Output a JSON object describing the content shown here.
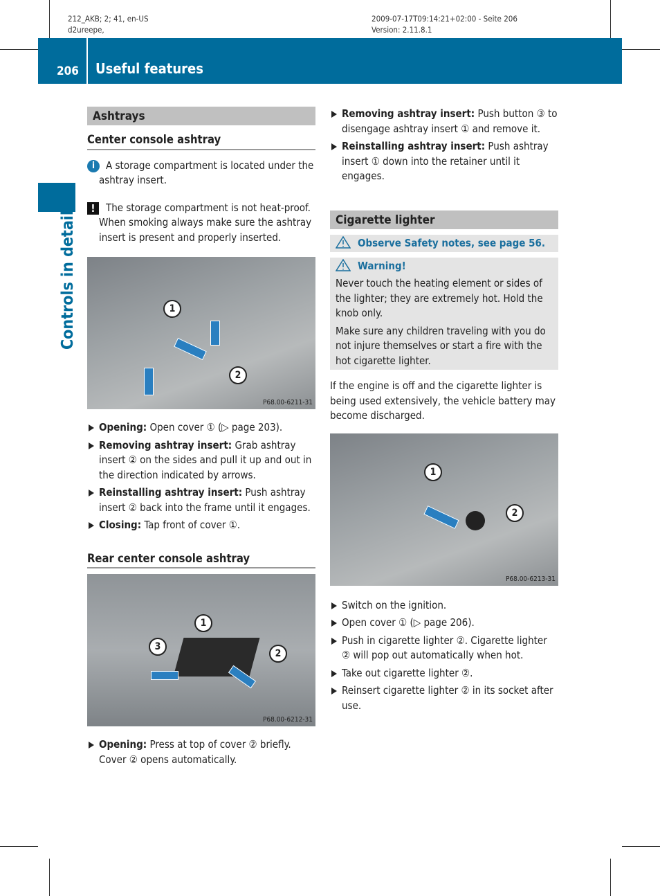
{
  "meta": {
    "left1": "212_AKB; 2; 41, en-US",
    "left2": "d2ureepe,",
    "right1": "2009-07-17T09:14:21+02:00 - Seite 206",
    "right2": "Version: 2.11.8.1"
  },
  "header": {
    "page_number": "206",
    "title": "Useful features",
    "accent": "#006c9c"
  },
  "side_tab": "Controls in detail",
  "left": {
    "section": "Ashtrays",
    "sub1": "Center console ashtray",
    "info_note": "A storage compartment is located under the ashtray insert.",
    "caution_note": "The storage compartment is not heat-proof. When smoking always make sure the ashtray insert is present and properly inserted.",
    "photo1": {
      "caption": "P68.00-6211-31",
      "callouts": [
        "1",
        "2"
      ]
    },
    "steps1": [
      {
        "bold": "Opening:",
        "text": " Open cover ① (▷ page 203)."
      },
      {
        "bold": "Removing ashtray insert:",
        "text": " Grab ashtray insert ② on the sides and pull it up and out in the direction indicated by arrows."
      },
      {
        "bold": "Reinstalling ashtray insert:",
        "text": " Push ashtray insert ② back into the frame until it engages."
      },
      {
        "bold": "Closing:",
        "text": " Tap front of cover ①."
      }
    ],
    "sub2": "Rear center console ashtray",
    "photo2": {
      "caption": "P68.00-6212-31",
      "callouts": [
        "1",
        "2",
        "3"
      ]
    },
    "steps2": [
      {
        "bold": "Opening:",
        "text": " Press at top of cover ② briefly. Cover ② opens automatically."
      }
    ]
  },
  "right": {
    "steps0": [
      {
        "bold": "Removing ashtray insert:",
        "text": " Push button ③ to disengage ashtray insert ① and remove it."
      },
      {
        "bold": "Reinstalling ashtray insert:",
        "text": " Push ashtray insert ① down into the retainer until it engages."
      }
    ],
    "section": "Cigarette lighter",
    "safety": "Observe Safety notes, see page 56.",
    "warning_title": "Warning!",
    "warning_p1": "Never touch the heating element or sides of the lighter; they are extremely hot. Hold the knob only.",
    "warning_p2": "Make sure any children traveling with you do not injure themselves or start a fire with the hot cigarette lighter.",
    "para": "If the engine is off and the cigarette lighter is being used extensively, the vehicle battery may become discharged.",
    "photo3": {
      "caption": "P68.00-6213-31",
      "callouts": [
        "1",
        "2"
      ]
    },
    "steps": [
      {
        "bold": "",
        "text": "Switch on the ignition."
      },
      {
        "bold": "",
        "text": "Open cover ① (▷ page 206)."
      },
      {
        "bold": "",
        "text": "Push in cigarette lighter ②. Cigarette lighter ② will pop out automatically when hot."
      },
      {
        "bold": "",
        "text": "Take out cigarette lighter ②."
      },
      {
        "bold": "",
        "text": "Reinsert cigarette lighter ② in its socket after use."
      }
    ]
  }
}
